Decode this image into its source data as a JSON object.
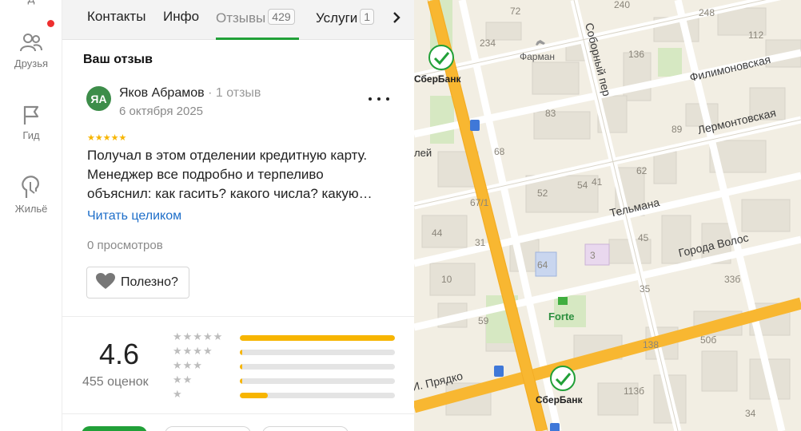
{
  "rail": {
    "top_clip_label": "Д",
    "items": [
      {
        "label": "Друзья",
        "icon": "friends-icon"
      },
      {
        "label": "Гид",
        "icon": "flag-icon"
      },
      {
        "label": "Жильё",
        "icon": "housing-icon"
      }
    ]
  },
  "tabs": {
    "items": [
      {
        "label": "Контакты"
      },
      {
        "label": "Инфо"
      },
      {
        "label": "Отзывы",
        "count": "429",
        "active": true
      },
      {
        "label": "Услуги",
        "count": "1"
      }
    ]
  },
  "review": {
    "section_title": "Ваш отзыв",
    "avatar_initials": "ЯА",
    "author": "Яков Абрамов",
    "author_reviews": "1 отзыв",
    "date": "6 октября 2025",
    "stars": "★★★★★",
    "text": "Получал в этом отделении кредитную карту. Менеджер все подробно и терпеливо объяснил: как гасить? какого числа? какую…",
    "read_more": "Читать целиком",
    "views": "0 просмотров",
    "useful_label": "Полезно?"
  },
  "rating": {
    "value": "4.6",
    "count_label": "455 оценок",
    "distribution": [
      {
        "stars": "★★★★★",
        "fraction": 1.0
      },
      {
        "stars": "★★★★",
        "fraction": 0.01
      },
      {
        "stars": "★★★",
        "fraction": 0.01
      },
      {
        "stars": "★★",
        "fraction": 0.01
      },
      {
        "stars": "★",
        "fraction": 0.18
      }
    ]
  },
  "map": {
    "streets": [
      "Филимоновская",
      "Лермонтовская",
      "Тельмана",
      "Города Волос",
      "Соборный пер",
      "И. Прядко"
    ],
    "pois": [
      "СберБанк",
      "Фарман",
      "Forte",
      "СберБанк"
    ],
    "edge_label": "лей",
    "house_numbers": [
      "72",
      "240",
      "248",
      "234",
      "112",
      "136",
      "83",
      "89",
      "68",
      "62",
      "41",
      "52",
      "54",
      "67/1",
      "44",
      "31",
      "45",
      "64",
      "3",
      "33б",
      "10",
      "35",
      "59",
      "138",
      "50б",
      "113б",
      "34"
    ]
  },
  "colors": {
    "accent": "#21a038",
    "link": "#1d6ec9",
    "star": "#f7b500",
    "road": "#f8b731",
    "map_bg": "#f2eee3"
  }
}
